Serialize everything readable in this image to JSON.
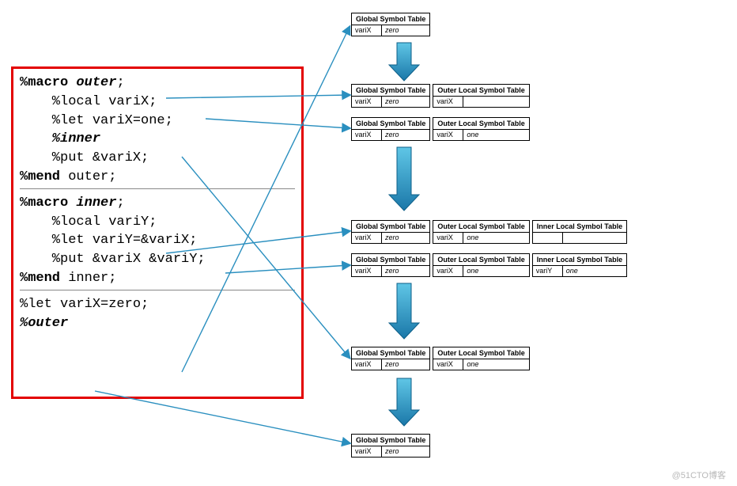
{
  "code": {
    "line1_kw": "%macro",
    "line1_name": " outer",
    "line2": "    %local variX;",
    "line3": "    %let variX=one;",
    "line4_kw": "    %",
    "line4_name": "inner",
    "line5": "    %put &variX;",
    "line6_kw": "%mend",
    "line6_txt": " outer;",
    "line7_kw": "%macro",
    "line7_name": " inner",
    "line8": "    %local variY;",
    "line9": "    %let variY=&variX;",
    "line10": "    %put &variX &variY;",
    "line11_kw": "%mend",
    "line11_txt": " inner;",
    "line12": "%let variX=zero;",
    "line13_kw": "%",
    "line13_name": "outer"
  },
  "tables": {
    "global_hdr": "Global Symbol Table",
    "outer_hdr": "Outer Local Symbol Table",
    "inner_hdr": "Inner Local Symbol Table",
    "varX": "variX",
    "varY": "variY",
    "zero": "zero",
    "one": "one",
    "empty": ""
  },
  "watermark": "@51CTO博客"
}
